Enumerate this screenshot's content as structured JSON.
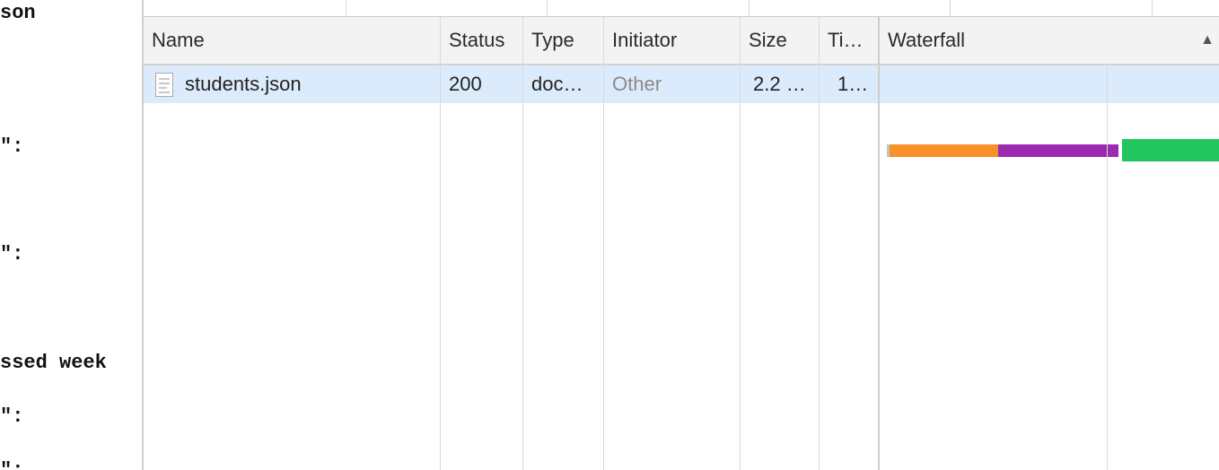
{
  "page_code": {
    "lines": [
      "son",
      "\":",
      "\":",
      "ssed week",
      "\":",
      "\":"
    ]
  },
  "network": {
    "columns": [
      {
        "key": "name",
        "label": "Name"
      },
      {
        "key": "status",
        "label": "Status"
      },
      {
        "key": "type",
        "label": "Type"
      },
      {
        "key": "initiator",
        "label": "Initiator"
      },
      {
        "key": "size",
        "label": "Size"
      },
      {
        "key": "time",
        "label": "Ti…"
      },
      {
        "key": "waterfall",
        "label": "Waterfall"
      }
    ],
    "sort_icon": "sort-ascending-icon",
    "row": {
      "name": "students.json",
      "file_icon": "document-icon",
      "status": "200",
      "type": "doc…",
      "initiator": "Other",
      "size": "2.2 …",
      "time": "1…"
    },
    "waterfall_colors": {
      "stalled": "#c4c4c4",
      "connect": "#f8902c",
      "ssl": "#9a2bb0",
      "download": "#22c55e"
    }
  }
}
